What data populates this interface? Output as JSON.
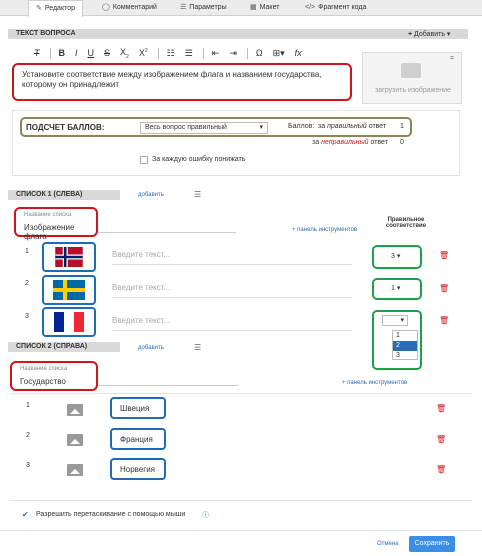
{
  "tabs": [
    {
      "label": "Редактор",
      "icon": "edit-icon"
    },
    {
      "label": "Комментарий",
      "icon": "comment-icon"
    },
    {
      "label": "Параметры",
      "icon": "sliders-icon"
    },
    {
      "label": "Макет",
      "icon": "layout-icon"
    },
    {
      "label": "Фрагмент кода",
      "icon": "code-icon"
    }
  ],
  "question": {
    "header": "ТЕКСТ ВОПРОСА",
    "add_label": "Добавить",
    "text": "Установите соответствие между изображением флага и названием государства, которому он принадлежит",
    "upload_label": "загрузить изображение"
  },
  "scoring": {
    "label": "ПОДСЧЕТ БАЛЛОВ:",
    "mode": "Весь вопрос правильный",
    "points_label": "Баллов:",
    "correct_pre": "за ",
    "correct_word": "правильный",
    "correct_post": " ответ",
    "correct_value": "1",
    "wrong_pre": "за ",
    "wrong_word": "неправильный",
    "wrong_post": " ответ",
    "wrong_value": "0",
    "penalty_label": "За каждую ошибку понижать"
  },
  "list1": {
    "header": "СПИСОК 1 (СЛЕВА)",
    "add_label": "добавить",
    "name_caption": "Название списка",
    "name_value": "Изображение флага",
    "toolbar_link": "+ панель инструментов",
    "match_header_1": "Правильное",
    "match_header_2": "соответствие",
    "placeholder": "Введите текст...",
    "items": [
      {
        "num": "1",
        "flag": "norway-flag",
        "match": "3"
      },
      {
        "num": "2",
        "flag": "sweden-flag",
        "match": "1"
      },
      {
        "num": "3",
        "flag": "france-flag",
        "match": ""
      }
    ],
    "dropdown_options": [
      "1",
      "2",
      "3"
    ],
    "dropdown_selected": "2"
  },
  "list2": {
    "header": "СПИСОК 2 (СПРАВА)",
    "add_label": "добавить",
    "name_caption": "Название списка",
    "name_value": "Государство",
    "toolbar_link": "+ панель инструментов",
    "items": [
      {
        "num": "1",
        "label": "Швеция"
      },
      {
        "num": "2",
        "label": "Франция"
      },
      {
        "num": "3",
        "label": "Норвегия"
      }
    ]
  },
  "footer": {
    "drag_label": "Разрешить перетаскивание с помощью мыши",
    "cancel_label": "Отмена",
    "save_label": "Сохранить"
  },
  "colors": {
    "accent": "#3a8ee6",
    "annotation_red": "#d0141c",
    "annotation_blue": "#1f6bb5",
    "annotation_green": "#1aa24a"
  }
}
